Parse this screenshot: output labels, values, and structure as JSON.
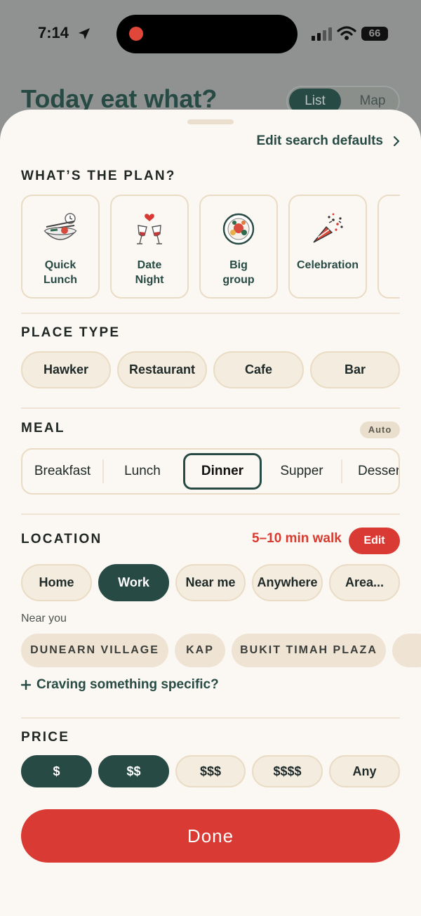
{
  "status_bar": {
    "time": "7:14",
    "battery": "66"
  },
  "header": {
    "title": "Today eat what?",
    "view_list": "List",
    "view_map": "Map"
  },
  "sheet": {
    "edit_defaults": "Edit search defaults",
    "plan": {
      "heading": "WHAT’S THE PLAN?",
      "cards": [
        {
          "label": "Quick Lunch",
          "icon": "noodle-bowl-clock-icon"
        },
        {
          "label": "Date Night",
          "icon": "wine-glasses-heart-icon"
        },
        {
          "label": "Big group",
          "icon": "shared-platter-icon"
        },
        {
          "label": "Celebration",
          "icon": "party-popper-icon"
        }
      ]
    },
    "place_type": {
      "heading": "PLACE TYPE",
      "options": [
        "Hawker",
        "Restaurant",
        "Cafe",
        "Bar"
      ]
    },
    "meal": {
      "heading": "MEAL",
      "badge": "Auto",
      "options": [
        "Breakfast",
        "Lunch",
        "Dinner",
        "Supper",
        "Dessert"
      ],
      "selected": "Dinner"
    },
    "location": {
      "heading": "LOCATION",
      "walk": "5–10 min walk",
      "edit": "Edit",
      "options": [
        "Home",
        "Work",
        "Near me",
        "Anywhere",
        "Area..."
      ],
      "selected": "Work",
      "near_label": "Near you",
      "near_places": [
        "DUNEARN VILLAGE",
        "KAP",
        "BUKIT TIMAH PLAZA"
      ],
      "craving": "Craving something specific?"
    },
    "price": {
      "heading": "PRICE",
      "options": [
        "$",
        "$$",
        "$$$",
        "$$$$",
        "Any"
      ],
      "selected": [
        "$",
        "$$"
      ]
    },
    "done": "Done"
  },
  "colors": {
    "primary": "#284a44",
    "accent": "#d93a33",
    "cream": "#f4ecdf",
    "sheet": "#fbf8f3"
  }
}
